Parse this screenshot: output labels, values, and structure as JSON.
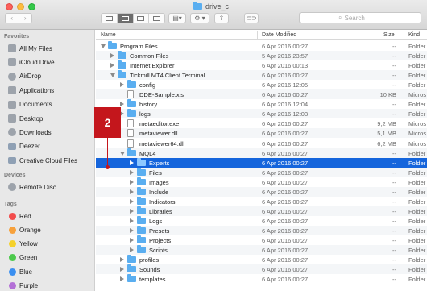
{
  "window": {
    "title": "drive_c"
  },
  "toolbar": {
    "back_glyph": "‹",
    "forward_glyph": "›",
    "action_glyph": "⚙ ▾",
    "share_glyph": "⇪",
    "tag_glyph": "⊂⊃",
    "search_placeholder": "Search"
  },
  "sidebar": {
    "favorites_label": "Favorites",
    "favorites": [
      {
        "label": "All My Files",
        "icon": "all-files-icon"
      },
      {
        "label": "iCloud Drive",
        "icon": "cloud-icon"
      },
      {
        "label": "AirDrop",
        "icon": "airdrop-icon"
      },
      {
        "label": "Applications",
        "icon": "applications-icon"
      },
      {
        "label": "Documents",
        "icon": "documents-icon"
      },
      {
        "label": "Desktop",
        "icon": "desktop-icon"
      },
      {
        "label": "Downloads",
        "icon": "downloads-icon"
      },
      {
        "label": "Deezer",
        "icon": "folder-icon"
      },
      {
        "label": "Creative Cloud Files",
        "icon": "folder-icon"
      }
    ],
    "devices_label": "Devices",
    "devices": [
      {
        "label": "Remote Disc",
        "icon": "disc-icon"
      }
    ],
    "tags_label": "Tags",
    "tags": [
      {
        "label": "Red",
        "color": "#f24c4c"
      },
      {
        "label": "Orange",
        "color": "#f7a13b"
      },
      {
        "label": "Yellow",
        "color": "#f5d12b"
      },
      {
        "label": "Green",
        "color": "#4cc94c"
      },
      {
        "label": "Blue",
        "color": "#3a8ff0"
      },
      {
        "label": "Purple",
        "color": "#b36fd6"
      }
    ]
  },
  "columns": {
    "name": "Name",
    "date": "Date Modified",
    "size": "Size",
    "kind": "Kind"
  },
  "rows": [
    {
      "name": "Program Files",
      "date": "6 Apr 2016 00:27",
      "size": "--",
      "kind": "Folder",
      "type": "folder",
      "expanded": true,
      "level": 0
    },
    {
      "name": "Common Files",
      "date": "5 Apr 2016 23:57",
      "size": "--",
      "kind": "Folder",
      "type": "folder",
      "expanded": false,
      "level": 1
    },
    {
      "name": "Internet Explorer",
      "date": "6 Apr 2016 00:13",
      "size": "--",
      "kind": "Folder",
      "type": "folder",
      "expanded": false,
      "level": 1
    },
    {
      "name": "Tickmill MT4 Client Terminal",
      "date": "6 Apr 2016 00:27",
      "size": "--",
      "kind": "Folder",
      "type": "folder",
      "expanded": true,
      "level": 1
    },
    {
      "name": "config",
      "date": "6 Apr 2016 12:05",
      "size": "--",
      "kind": "Folder",
      "type": "folder",
      "expanded": false,
      "level": 2
    },
    {
      "name": "DDE-Sample.xls",
      "date": "6 Apr 2016 00:27",
      "size": "10 KB",
      "kind": "Micros",
      "type": "file",
      "level": 2
    },
    {
      "name": "history",
      "date": "6 Apr 2016 12:04",
      "size": "--",
      "kind": "Folder",
      "type": "folder",
      "expanded": false,
      "level": 2
    },
    {
      "name": "logs",
      "date": "6 Apr 2016 12:03",
      "size": "--",
      "kind": "Folder",
      "type": "folder",
      "expanded": false,
      "level": 2
    },
    {
      "name": "metaeditor.exe",
      "date": "6 Apr 2016 00:27",
      "size": "9,2 MB",
      "kind": "Micros",
      "type": "file",
      "level": 2
    },
    {
      "name": "metaviewer.dll",
      "date": "6 Apr 2016 00:27",
      "size": "5,1 MB",
      "kind": "Micros",
      "type": "file",
      "level": 2
    },
    {
      "name": "metaviewer64.dll",
      "date": "6 Apr 2016 00:27",
      "size": "6,2 MB",
      "kind": "Micros",
      "type": "file",
      "level": 2
    },
    {
      "name": "MQL4",
      "date": "6 Apr 2016 00:27",
      "size": "--",
      "kind": "Folder",
      "type": "folder",
      "expanded": true,
      "level": 2
    },
    {
      "name": "Experts",
      "date": "6 Apr 2016 00:27",
      "size": "--",
      "kind": "Folder",
      "type": "folder",
      "expanded": false,
      "level": 3,
      "selected": true
    },
    {
      "name": "Files",
      "date": "6 Apr 2016 00:27",
      "size": "--",
      "kind": "Folder",
      "type": "folder",
      "expanded": false,
      "level": 3
    },
    {
      "name": "Images",
      "date": "6 Apr 2016 00:27",
      "size": "--",
      "kind": "Folder",
      "type": "folder",
      "expanded": false,
      "level": 3
    },
    {
      "name": "Include",
      "date": "6 Apr 2016 00:27",
      "size": "--",
      "kind": "Folder",
      "type": "folder",
      "expanded": false,
      "level": 3
    },
    {
      "name": "Indicators",
      "date": "6 Apr 2016 00:27",
      "size": "--",
      "kind": "Folder",
      "type": "folder",
      "expanded": false,
      "level": 3
    },
    {
      "name": "Libraries",
      "date": "6 Apr 2016 00:27",
      "size": "--",
      "kind": "Folder",
      "type": "folder",
      "expanded": false,
      "level": 3
    },
    {
      "name": "Logs",
      "date": "6 Apr 2016 00:27",
      "size": "--",
      "kind": "Folder",
      "type": "folder",
      "expanded": false,
      "level": 3
    },
    {
      "name": "Presets",
      "date": "6 Apr 2016 00:27",
      "size": "--",
      "kind": "Folder",
      "type": "folder",
      "expanded": false,
      "level": 3
    },
    {
      "name": "Projects",
      "date": "6 Apr 2016 00:27",
      "size": "--",
      "kind": "Folder",
      "type": "folder",
      "expanded": false,
      "level": 3
    },
    {
      "name": "Scripts",
      "date": "6 Apr 2016 00:27",
      "size": "--",
      "kind": "Folder",
      "type": "folder",
      "expanded": false,
      "level": 3
    },
    {
      "name": "profiles",
      "date": "6 Apr 2016 00:27",
      "size": "--",
      "kind": "Folder",
      "type": "folder",
      "expanded": false,
      "level": 2
    },
    {
      "name": "Sounds",
      "date": "6 Apr 2016 00:27",
      "size": "--",
      "kind": "Folder",
      "type": "folder",
      "expanded": false,
      "level": 2
    },
    {
      "name": "templates",
      "date": "6 Apr 2016 00:27",
      "size": "--",
      "kind": "Folder",
      "type": "folder",
      "expanded": false,
      "level": 2
    }
  ],
  "annotation": {
    "label": "2"
  }
}
